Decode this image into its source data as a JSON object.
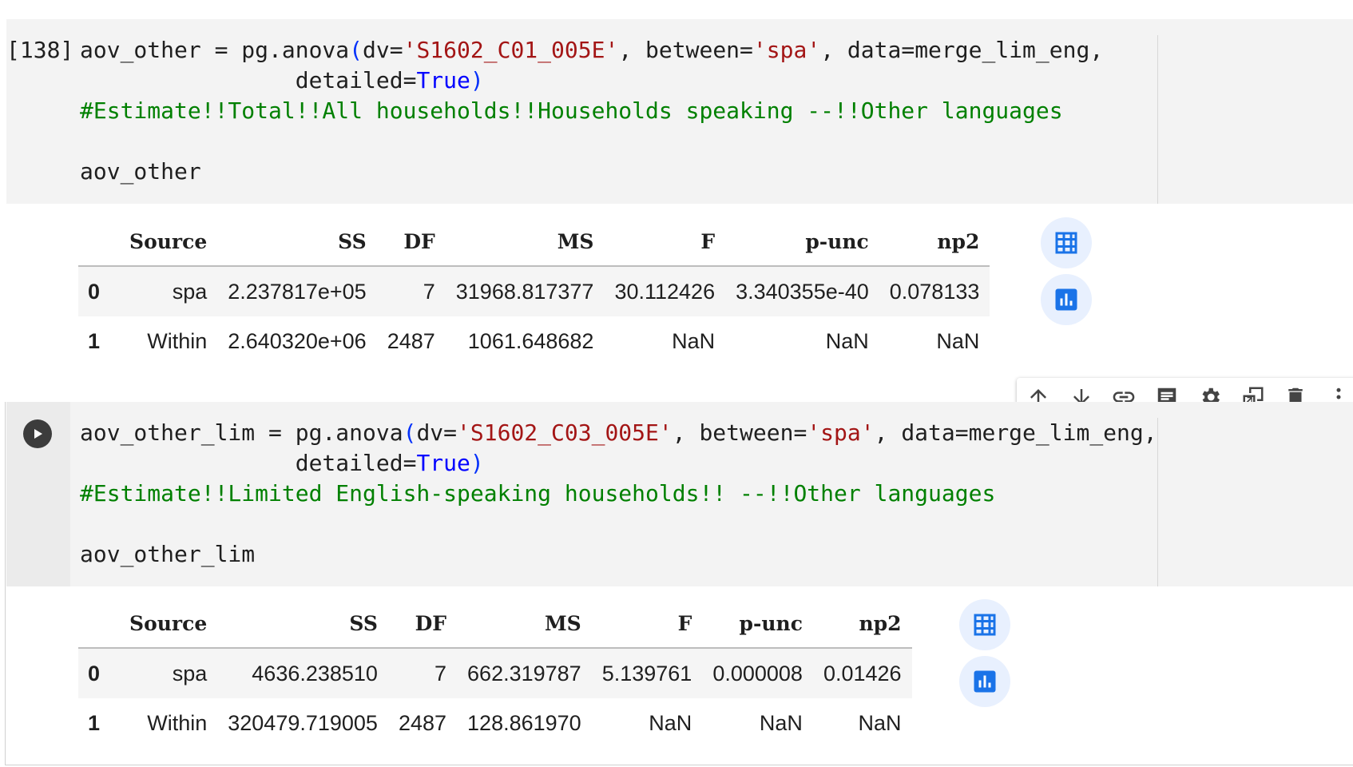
{
  "cell1": {
    "exec_count": "[138]",
    "lines": {
      "l1_a": "aov_other = pg.anova",
      "l1_b": "(",
      "l1_c": "dv=",
      "l1_d": "'S1602_C01_005E'",
      "l1_e": ", between=",
      "l1_f": "'spa'",
      "l1_g": ", data=merge_lim_eng,",
      "l2_a": "                detailed=",
      "l2_b": "True",
      "l2_c": ")",
      "comment": "#Estimate!!Total!!All households!!Households speaking --!!Other languages",
      "l5": "aov_other"
    }
  },
  "table1": {
    "headers": [
      "Source",
      "SS",
      "DF",
      "MS",
      "F",
      "p-unc",
      "np2"
    ],
    "rows": [
      {
        "index": "0",
        "cells": [
          "spa",
          "2.237817e+05",
          "7",
          "31968.817377",
          "30.112426",
          "3.340355e-40",
          "0.078133"
        ]
      },
      {
        "index": "1",
        "cells": [
          "Within",
          "2.640320e+06",
          "2487",
          "1061.648682",
          "NaN",
          "NaN",
          "NaN"
        ]
      }
    ]
  },
  "cell2": {
    "lines": {
      "l1_a": "aov_other_lim = pg.anova",
      "l1_b": "(",
      "l1_c": "dv=",
      "l1_d": "'S1602_C03_005E'",
      "l1_e": ", between=",
      "l1_f": "'spa'",
      "l1_g": ", data=merge_lim_eng,",
      "l2_a": "                detailed=",
      "l2_b": "True",
      "l2_c": ")",
      "comment": "#Estimate!!Limited English-speaking households!! --!!Other languages",
      "l5": "aov_other_lim"
    }
  },
  "table2": {
    "headers": [
      "Source",
      "SS",
      "DF",
      "MS",
      "F",
      "p-unc",
      "np2"
    ],
    "rows": [
      {
        "index": "0",
        "cells": [
          "spa",
          "4636.238510",
          "7",
          "662.319787",
          "5.139761",
          "0.000008",
          "0.01426"
        ]
      },
      {
        "index": "1",
        "cells": [
          "Within",
          "320479.719005",
          "2487",
          "128.861970",
          "NaN",
          "NaN",
          "NaN"
        ]
      }
    ]
  },
  "toolbar": {
    "icons": [
      "arrow-up-icon",
      "arrow-down-icon",
      "link-icon",
      "comment-icon",
      "gear-icon",
      "mirror-cell-icon",
      "trash-icon",
      "more-vert-icon"
    ]
  },
  "colors": {
    "string": "#a31515",
    "keyword": "#0000ff",
    "comment": "#008000",
    "button_bg": "#e8f0fe",
    "button_fg": "#1a73e8"
  }
}
